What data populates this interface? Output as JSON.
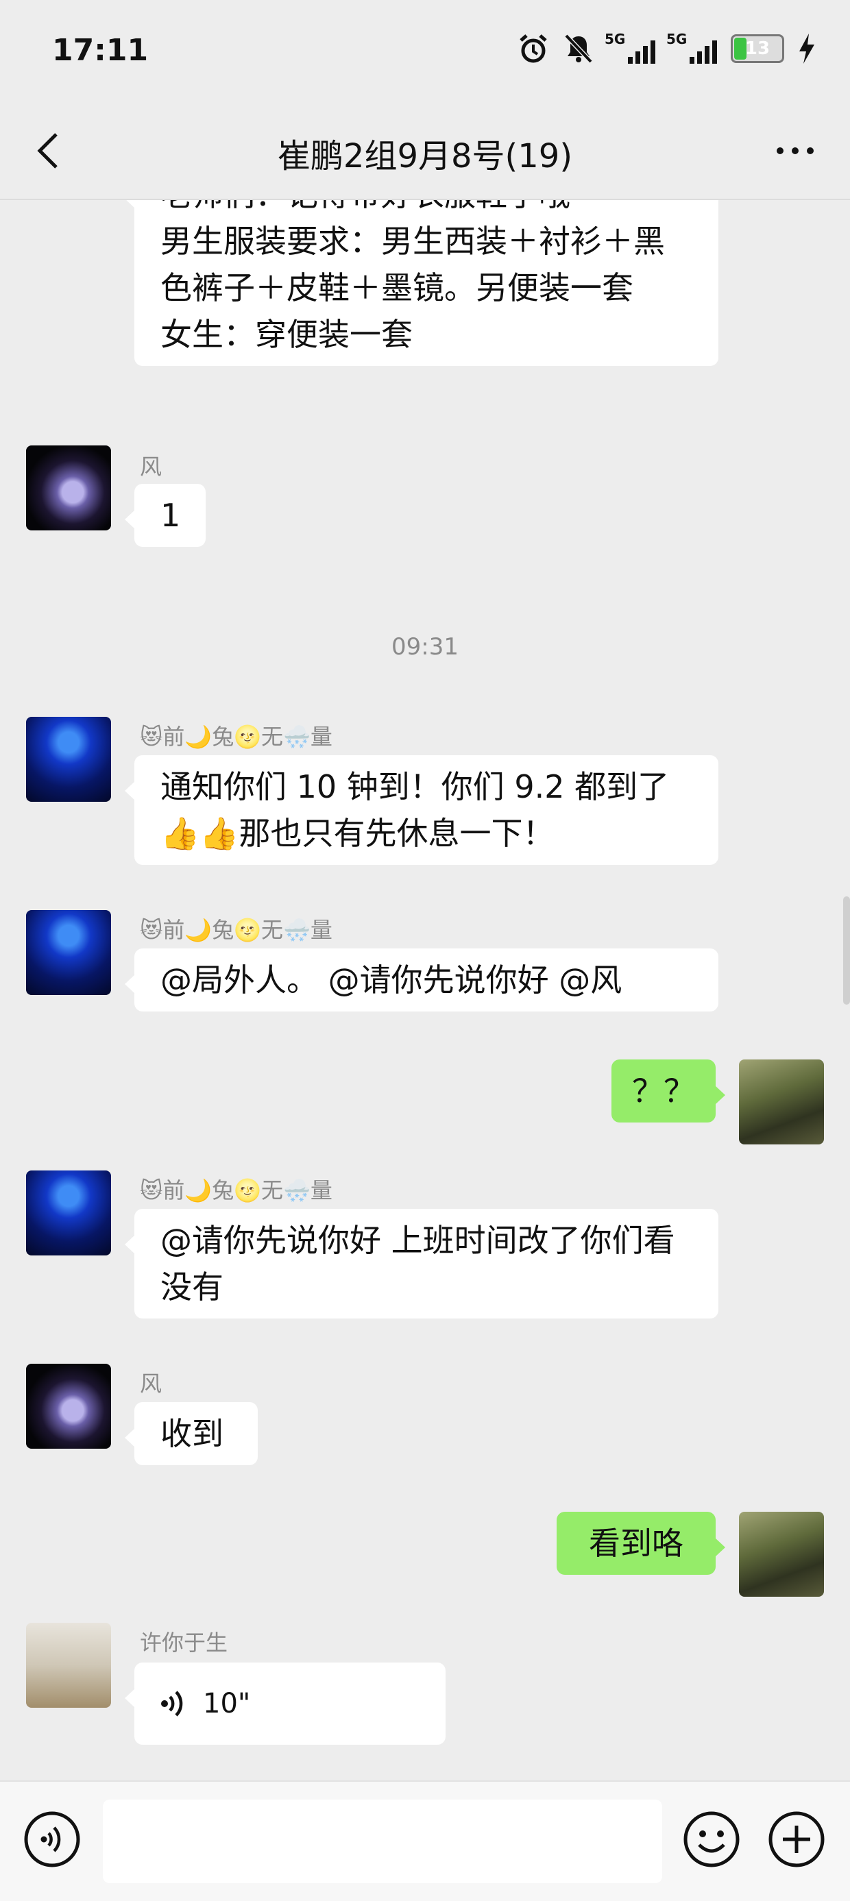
{
  "status_bar": {
    "time": "17:11",
    "network1": "5G",
    "network2": "5G",
    "battery": "13"
  },
  "header": {
    "title": "崔鹏2组9月8号(19)"
  },
  "messages": {
    "m0": {
      "text": "老师们：记得带好衣服鞋子哦\n男生服装要求：男生西装＋衬衫＋黑色裤子＋皮鞋＋墨镜。另便装一套\n女生：穿便装一套"
    },
    "m1": {
      "sender": "风",
      "text": "1"
    },
    "timestamp": "09:31",
    "m2": {
      "sender": "😻前🌙兔🌝无🌨️量",
      "text": "通知你们 10 钟到！你们 9.2 都到了👍👍那也只有先休息一下！"
    },
    "m3": {
      "sender": "😻前🌙兔🌝无🌨️量",
      "text": "@局外人。 @请你先说你好  @风"
    },
    "m4": {
      "text": "？？"
    },
    "m5": {
      "sender": "😻前🌙兔🌝无🌨️量",
      "text": "@请你先说你好  上班时间改了你们看没有"
    },
    "m6": {
      "sender": "风",
      "text": "收到"
    },
    "m7": {
      "text": "看到咯"
    },
    "m8": {
      "sender": "许你于生",
      "duration": "10\""
    }
  },
  "icons": {
    "back": "chevron-left-icon",
    "more": "more-horizontal-icon",
    "voice": "voice-mode-icon",
    "emoji": "emoji-icon",
    "plus": "plus-icon",
    "wave": "voice-wave-icon"
  },
  "colors": {
    "background": "#ededed",
    "my_bubble": "#95ec69",
    "other_bubble": "#ffffff",
    "battery": "#3cc443"
  }
}
